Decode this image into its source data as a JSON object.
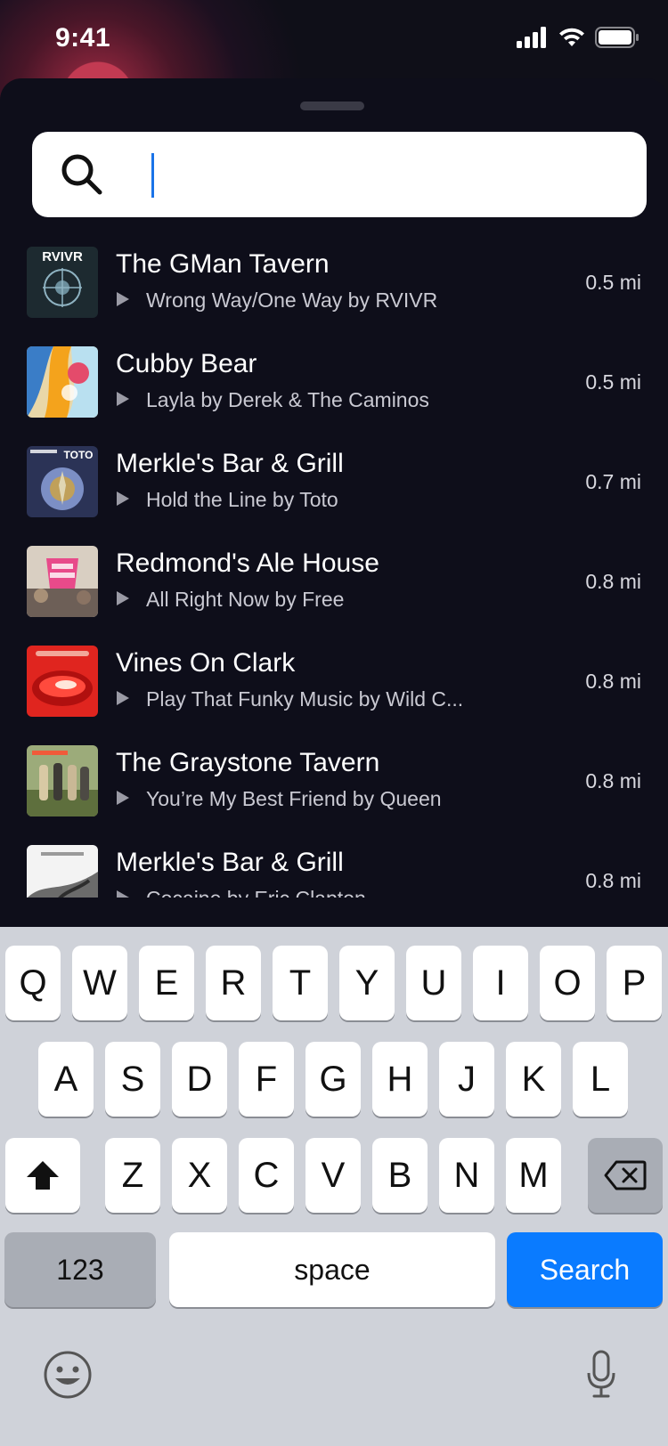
{
  "status": {
    "time": "9:41"
  },
  "search": {
    "placeholder": "",
    "value": ""
  },
  "results": [
    {
      "venue": "The GMan Tavern",
      "track": "Wrong Way/One Way by RVIVR",
      "distance": "0.5 mi",
      "cover_text": "RVIVR"
    },
    {
      "venue": "Cubby Bear",
      "track": "Layla by Derek & The Caminos",
      "distance": "0.5 mi"
    },
    {
      "venue": "Merkle's Bar & Grill",
      "track": "Hold the Line by Toto",
      "distance": "0.7 mi",
      "cover_text": "TOTO"
    },
    {
      "venue": "Redmond's Ale House",
      "track": "All Right Now by Free",
      "distance": "0.8 mi"
    },
    {
      "venue": "Vines On Clark",
      "track": "Play That Funky Music by Wild C...",
      "distance": "0.8 mi"
    },
    {
      "venue": "The Graystone Tavern",
      "track": "You’re My Best Friend by Queen",
      "distance": "0.8 mi"
    },
    {
      "venue": "Merkle's Bar & Grill",
      "track": "Cocaine by Eric Clapton",
      "distance": "0.8 mi"
    }
  ],
  "keyboard": {
    "row1": [
      "Q",
      "W",
      "E",
      "R",
      "T",
      "Y",
      "U",
      "I",
      "O",
      "P"
    ],
    "row2": [
      "A",
      "S",
      "D",
      "F",
      "G",
      "H",
      "J",
      "K",
      "L"
    ],
    "row3": [
      "Z",
      "X",
      "C",
      "V",
      "B",
      "N",
      "M"
    ],
    "numbers_label": "123",
    "space_label": "space",
    "search_label": "Search"
  },
  "icons": [
    "signal-icon",
    "wifi-icon",
    "battery-icon",
    "search-icon",
    "play-icon",
    "shift-icon",
    "backspace-icon",
    "emoji-icon",
    "microphone-icon"
  ]
}
